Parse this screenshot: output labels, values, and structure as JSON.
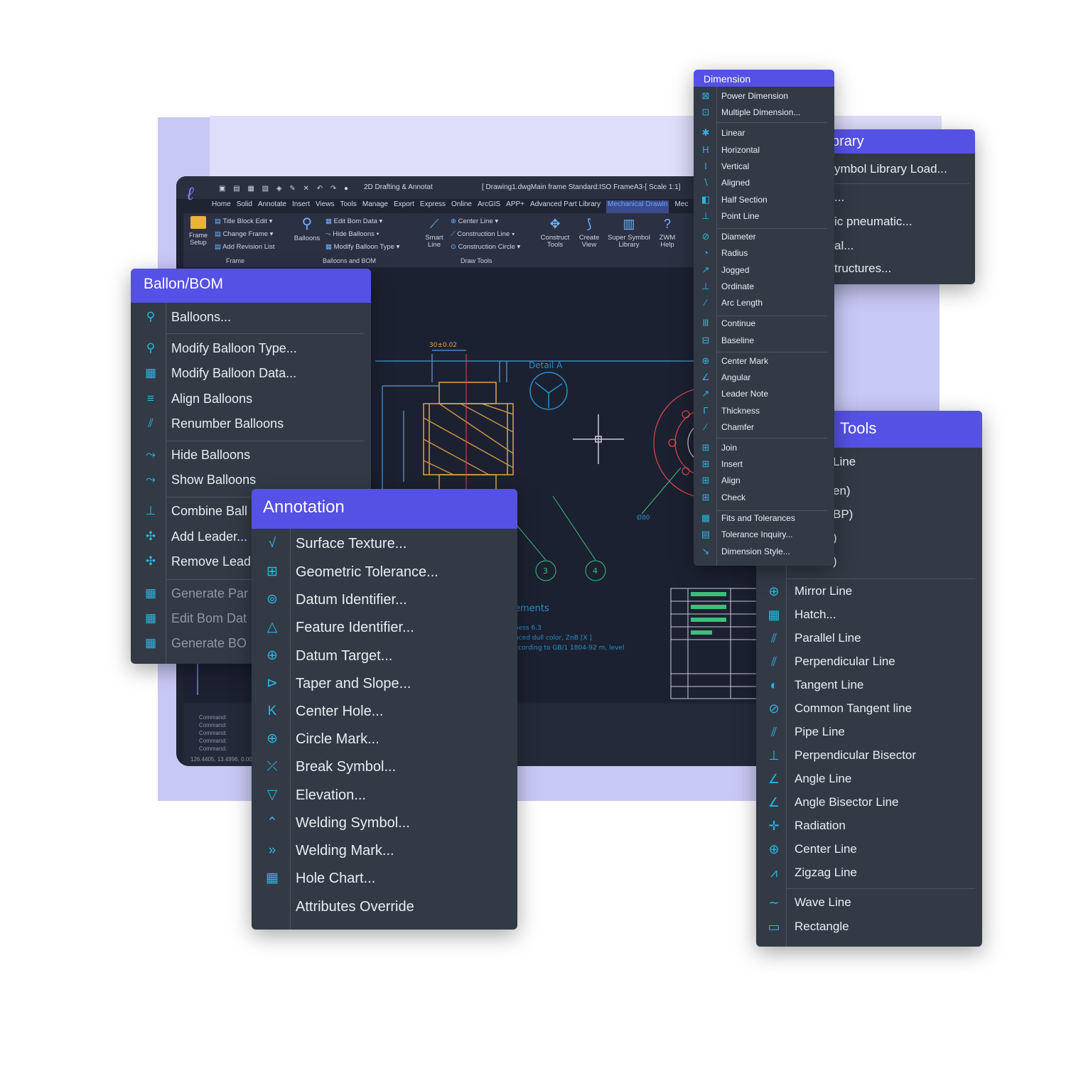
{
  "app": {
    "workspace": "2D Drafting & Annotat",
    "document": "[ Drawing1.dwgMain frame Standard:ISO FrameA3-[ Scale 1:1]",
    "menus": [
      "Home",
      "Solid",
      "Annotate",
      "Insert",
      "Views",
      "Tools",
      "Manage",
      "Export",
      "Express",
      "Online",
      "ArcGIS",
      "APP+",
      "Advanced Part Library",
      "Mechanical Drawin",
      "Mec"
    ],
    "active_menu_index": 13,
    "ribbon": {
      "frame_setup": "Frame Setup",
      "title_block_edit": "Title Block Edit",
      "change_frame": "Change Frame",
      "add_revision_list": "Add Revision List",
      "frame_group": "Frame",
      "balloons": "Balloons",
      "edit_bom_data": "Edit Bom Data",
      "hide_balloons": "Hide Balloons",
      "modify_balloon_type": "Modify Balloon Type",
      "balloons_bom_group": "Balloons and BOM",
      "smart_line": "Smart Line",
      "center_line": "Center Line",
      "construction_line": "Construction Line",
      "construction_circle": "Construction Circle",
      "draw_tools_group": "Draw Tools",
      "construct_tools": "Construct Tools",
      "create_view": "Create View",
      "super_symbol_library": "Super Symbol Library",
      "zwm_help": "ZWM Help"
    },
    "canvas": {
      "detail_label": "Detail A",
      "dim_top": "30±0.02",
      "requirements": "ements",
      "note_1": "ness 6.3",
      "note_2": "nced dull color, ZnB [X ]",
      "note_3": "ccording to GB/1 1804-92 m, level",
      "balloon_3": "3",
      "balloon_4": "4",
      "dim_phi": "Ø80",
      "commands": [
        "Command:",
        "Command:",
        "Command:",
        "Command:",
        "Command:"
      ],
      "status": "126.4405, 13.4996, 0.0000"
    }
  },
  "balloon_bom": {
    "title": "Ballon/BOM",
    "items": [
      {
        "label": "Balloons...",
        "icon": "balloons-icon",
        "glyph": "⚲"
      },
      {
        "label": "Modify Balloon Type...",
        "icon": "modify-balloon-type-icon",
        "glyph": "⚲"
      },
      {
        "label": "Modify Balloon Data...",
        "icon": "modify-balloon-data-icon",
        "glyph": "▦"
      },
      {
        "label": "Align Balloons",
        "icon": "align-balloons-icon",
        "glyph": "≡"
      },
      {
        "label": "Renumber Balloons",
        "icon": "renumber-balloons-icon",
        "glyph": "⫽"
      },
      {
        "label": "Hide Balloons",
        "icon": "hide-balloons-icon",
        "glyph": "⤳"
      },
      {
        "label": "Show Balloons",
        "icon": "show-balloons-icon",
        "glyph": "⤳"
      },
      {
        "label": "Combine Ball",
        "icon": "combine-balloons-icon",
        "glyph": "⊥"
      },
      {
        "label": "Add Leader...",
        "icon": "add-leader-icon",
        "glyph": "✣"
      },
      {
        "label": "Remove Lead",
        "icon": "remove-leader-icon",
        "glyph": "✣"
      },
      {
        "label": "Generate Par",
        "icon": "generate-parts-icon",
        "glyph": "▦"
      },
      {
        "label": "Edit Bom Dat",
        "icon": "edit-bom-data-icon",
        "glyph": "▦"
      },
      {
        "label": "Generate BO",
        "icon": "generate-bom-icon",
        "glyph": "▦"
      }
    ]
  },
  "annotation": {
    "title": "Annotation",
    "items": [
      {
        "label": "Surface Texture...",
        "icon": "surface-texture-icon",
        "glyph": "√"
      },
      {
        "label": "Geometric Tolerance...",
        "icon": "geometric-tolerance-icon",
        "glyph": "⊞"
      },
      {
        "label": "Datum Identifier...",
        "icon": "datum-identifier-icon",
        "glyph": "⊚"
      },
      {
        "label": "Feature Identifier...",
        "icon": "feature-identifier-icon",
        "glyph": "△"
      },
      {
        "label": "Datum Target...",
        "icon": "datum-target-icon",
        "glyph": "⊕"
      },
      {
        "label": "Taper and Slope...",
        "icon": "taper-slope-icon",
        "glyph": "⊳"
      },
      {
        "label": "Center Hole...",
        "icon": "center-hole-icon",
        "glyph": "K"
      },
      {
        "label": "Circle Mark...",
        "icon": "circle-mark-icon",
        "glyph": "⊕"
      },
      {
        "label": "Break Symbol...",
        "icon": "break-symbol-icon",
        "glyph": "⤫"
      },
      {
        "label": "Elevation...",
        "icon": "elevation-icon",
        "glyph": "▽"
      },
      {
        "label": "Welding Symbol...",
        "icon": "welding-symbol-icon",
        "glyph": "⌃"
      },
      {
        "label": "Welding Mark...",
        "icon": "welding-mark-icon",
        "glyph": "»"
      },
      {
        "label": "Hole Chart...",
        "icon": "hole-chart-icon",
        "glyph": "▦"
      },
      {
        "label": "Attributes Override",
        "icon": "",
        "glyph": ""
      }
    ]
  },
  "dimension": {
    "title": "Dimension",
    "items": [
      {
        "label": "Power Dimension",
        "icon": "power-dimension-icon",
        "glyph": "⊠"
      },
      {
        "label": "Multiple Dimension...",
        "icon": "multiple-dimension-icon",
        "glyph": "⊡"
      },
      {
        "label": "Linear",
        "icon": "linear-icon",
        "glyph": "✱"
      },
      {
        "label": "Horizontal",
        "icon": "horizontal-icon",
        "glyph": "H"
      },
      {
        "label": "Vertical",
        "icon": "vertical-icon",
        "glyph": "I"
      },
      {
        "label": "Aligned",
        "icon": "aligned-icon",
        "glyph": "∖"
      },
      {
        "label": "Half Section",
        "icon": "half-section-icon",
        "glyph": "◧"
      },
      {
        "label": "Point Line",
        "icon": "point-line-icon",
        "glyph": "⊥"
      },
      {
        "label": "Diameter",
        "icon": "diameter-icon",
        "glyph": "⊘"
      },
      {
        "label": "Radius",
        "icon": "radius-icon",
        "glyph": "◔"
      },
      {
        "label": "Jogged",
        "icon": "jogged-icon",
        "glyph": "↗"
      },
      {
        "label": "Ordinate",
        "icon": "ordinate-icon",
        "glyph": "⊥"
      },
      {
        "label": "Arc Length",
        "icon": "arc-length-icon",
        "glyph": "⁄"
      },
      {
        "label": "Continue",
        "icon": "continue-icon",
        "glyph": "Ⅲ"
      },
      {
        "label": "Baseline",
        "icon": "baseline-icon",
        "glyph": "⊟"
      },
      {
        "label": "Center Mark",
        "icon": "center-mark-icon",
        "glyph": "⊕"
      },
      {
        "label": "Angular",
        "icon": "angular-icon",
        "glyph": "∠"
      },
      {
        "label": "Leader Note",
        "icon": "leader-note-icon",
        "glyph": "↗"
      },
      {
        "label": "Thickness",
        "icon": "thickness-icon",
        "glyph": "Γ"
      },
      {
        "label": "Chamfer",
        "icon": "chamfer-icon",
        "glyph": "∕"
      },
      {
        "label": "Join",
        "icon": "join-icon",
        "glyph": "⊞"
      },
      {
        "label": "Insert",
        "icon": "insert-icon",
        "glyph": "⊞"
      },
      {
        "label": "Align",
        "icon": "align-icon",
        "glyph": "⊞"
      },
      {
        "label": "Check",
        "icon": "check-icon",
        "glyph": "⊞"
      },
      {
        "label": "Fits and Tolerances",
        "icon": "fits-tolerances-icon",
        "glyph": "▦"
      },
      {
        "label": "Tolerance Inquiry...",
        "icon": "tolerance-inquiry-icon",
        "glyph": "▤"
      },
      {
        "label": "Dimension Style...",
        "icon": "dimension-style-icon",
        "glyph": "↘"
      }
    ]
  },
  "symbol_library": {
    "title": "brary",
    "items": [
      "ymbol Library Load...",
      "...",
      "ic pneumatic...",
      "al...",
      "tructures..."
    ]
  },
  "draw_tools": {
    "title": "Tools",
    "partial": [
      "Line",
      "en)",
      "BP)",
      ")",
      ")"
    ],
    "items": [
      {
        "label": "Mirror Line",
        "icon": "mirror-line-icon",
        "glyph": "⊕"
      },
      {
        "label": "Hatch...",
        "icon": "hatch-icon",
        "glyph": "▦"
      },
      {
        "label": "Parallel Line",
        "icon": "parallel-line-icon",
        "glyph": "⫽"
      },
      {
        "label": "Perpendicular Line",
        "icon": "perpendicular-line-icon",
        "glyph": "⫽"
      },
      {
        "label": "Tangent Line",
        "icon": "tangent-line-icon",
        "glyph": "◐"
      },
      {
        "label": "Common Tangent line",
        "icon": "common-tangent-line-icon",
        "glyph": "⊘"
      },
      {
        "label": "Pipe Line",
        "icon": "pipe-line-icon",
        "glyph": "⫽"
      },
      {
        "label": "Perpendicular Bisector",
        "icon": "perpendicular-bisector-icon",
        "glyph": "⊥"
      },
      {
        "label": "Angle Line",
        "icon": "angle-line-icon",
        "glyph": "∠"
      },
      {
        "label": "Angle Bisector Line",
        "icon": "angle-bisector-line-icon",
        "glyph": "∠"
      },
      {
        "label": "Radiation",
        "icon": "radiation-icon",
        "glyph": "✛"
      },
      {
        "label": "Center Line",
        "icon": "center-line-icon",
        "glyph": "⊕"
      },
      {
        "label": "Zigzag Line",
        "icon": "zigzag-line-icon",
        "glyph": "⩘"
      },
      {
        "label": "Wave Line",
        "icon": "wave-line-icon",
        "glyph": "∼"
      },
      {
        "label": "Rectangle",
        "icon": "rectangle-icon",
        "glyph": "▭"
      }
    ]
  },
  "colors": {
    "accent": "#5551e4",
    "panel_bg": "#323a46",
    "canvas_bg": "#1c2131",
    "icon_cyan": "#2bb7e0"
  }
}
